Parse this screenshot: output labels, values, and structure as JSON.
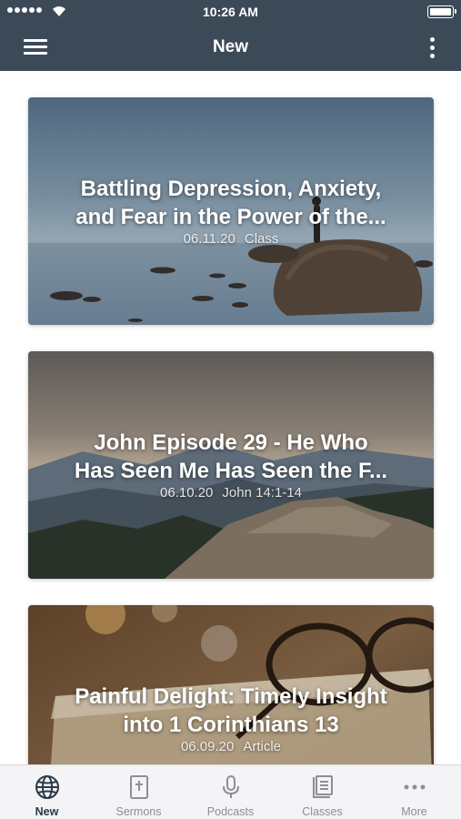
{
  "status_bar": {
    "time": "10:26 AM"
  },
  "header": {
    "title": "New"
  },
  "cards": [
    {
      "title_line1": "Battling Depression, Anxiety,",
      "title_line2": "and Fear in the Power of the...",
      "date": "06.11.20",
      "category": "Class",
      "image": "lake-rocks-person"
    },
    {
      "title_line1": "John Episode 29 - He Who",
      "title_line2": "Has Seen Me Has Seen the F...",
      "date": "06.10.20",
      "category": "John 14:1-14",
      "image": "mountain-landscape"
    },
    {
      "title_line1": "Painful Delight: Timely Insight",
      "title_line2": "into 1 Corinthians 13",
      "date": "06.09.20",
      "category": "Article",
      "image": "glasses-on-bible"
    }
  ],
  "tabs": [
    {
      "label": "New",
      "icon": "globe-icon",
      "active": true
    },
    {
      "label": "Sermons",
      "icon": "bible-cross-icon",
      "active": false
    },
    {
      "label": "Podcasts",
      "icon": "microphone-icon",
      "active": false
    },
    {
      "label": "Classes",
      "icon": "book-icon",
      "active": false
    },
    {
      "label": "More",
      "icon": "more-dots-icon",
      "active": false
    }
  ],
  "colors": {
    "header_bg": "#3c4a58",
    "tab_active": "#2c3a48",
    "tab_inactive": "#8e8e93",
    "tab_bar_bg": "#f4f4f6"
  }
}
